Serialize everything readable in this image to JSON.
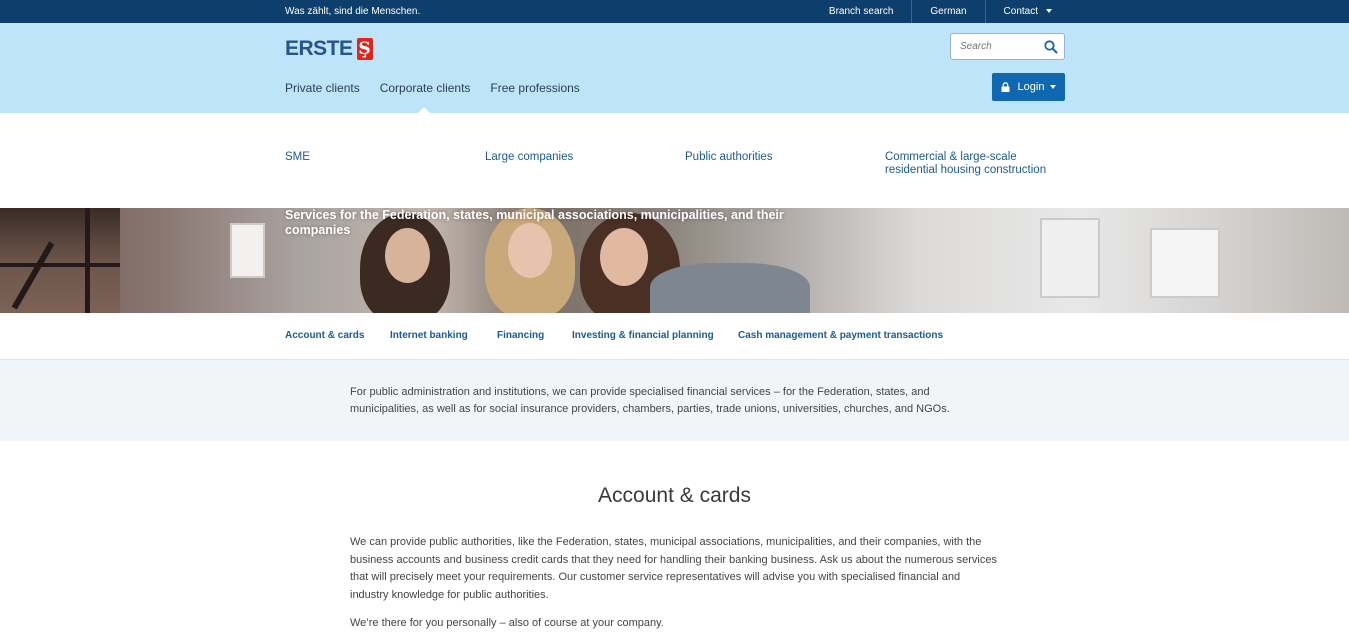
{
  "topbar": {
    "slogan": "Was zählt, sind die Menschen.",
    "links": {
      "branch_search": "Branch search",
      "language": "German",
      "contact": "Contact"
    }
  },
  "header": {
    "logo_text": "ERSTE",
    "logo_mark": "Ş",
    "nav": {
      "private": "Private clients",
      "corporate": "Corporate clients",
      "free": "Free professions"
    },
    "search_placeholder": "Search",
    "login_label": "Login"
  },
  "subnav": {
    "sme": "SME",
    "large": "Large companies",
    "public": "Public authorities",
    "commercial": "Commercial & large-scale residential housing construction"
  },
  "hero": {
    "title": "Services for the Federation, states, municipal associations, municipalities, and their companies"
  },
  "tabs": {
    "account": "Account & cards",
    "internet": "Internet banking",
    "financing": "Financing",
    "investing": "Investing & financial planning",
    "cash": "Cash management & payment transactions"
  },
  "intro": {
    "text": "For public administration and institutions, we can provide specialised financial services – for the Federation, states, and municipalities, as well as for social insurance providers, chambers, parties, trade unions, universities, churches, and NGOs."
  },
  "content": {
    "heading": "Account & cards",
    "paragraph1": "We can provide public authorities, like the Federation, states, municipal associations, municipalities, and their companies, with the business accounts and business credit cards that they need for handling their banking business. Ask us about the numerous services that will precisely meet your requirements. Our customer service representatives will advise you with specialised financial and industry knowledge for public authorities.",
    "paragraph2": "We’re there for you personally – also of course at your company."
  },
  "colors": {
    "topbar": "#0e3f6c",
    "header": "#bde4f8",
    "brand_blue": "#2a5389",
    "brand_red": "#e3241b",
    "link": "#1b5a95",
    "login_button": "#1069b0"
  },
  "icons": [
    "caret-down-icon",
    "search-icon",
    "lock-icon"
  ]
}
